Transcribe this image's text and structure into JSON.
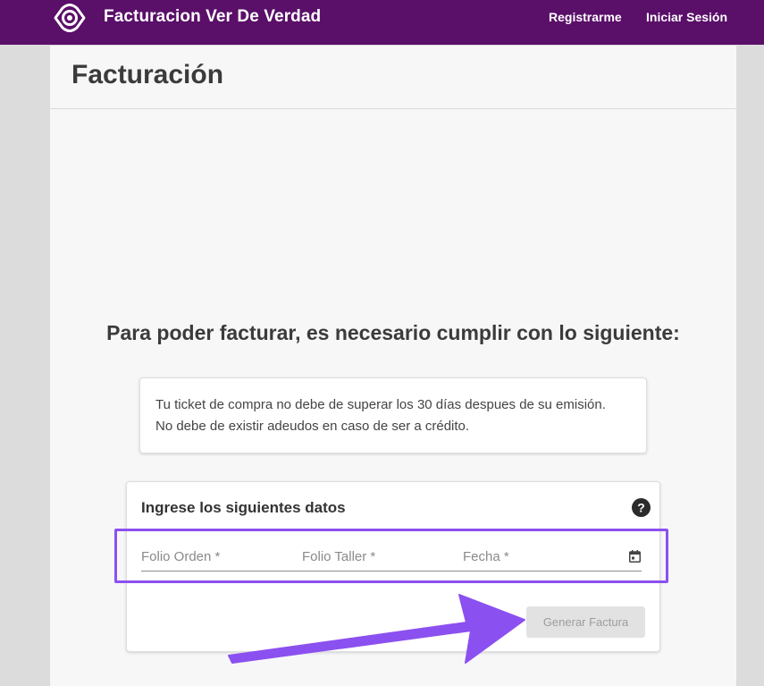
{
  "header": {
    "app_title": "Facturacion Ver De Verdad",
    "nav": {
      "register": "Registrarme",
      "login": "Iniciar Sesión"
    },
    "logo_icon": "eye-logo-icon",
    "background_color": "#5a0f69"
  },
  "page": {
    "title": "Facturación"
  },
  "requirements": {
    "heading": "Para poder facturar, es necesario cumplir con lo siguiente:",
    "items": [
      "Tu ticket de compra no debe de superar los 30 días despues de su emisión.",
      "No debe de existir adeudos en caso de ser a crédito."
    ]
  },
  "form": {
    "title": "Ingrese los siguientes datos",
    "help_icon": "help-circle-icon",
    "fields": {
      "folio_orden": {
        "placeholder": "Folio Orden *",
        "value": ""
      },
      "folio_taller": {
        "placeholder": "Folio Taller *",
        "value": ""
      },
      "fecha": {
        "placeholder": "Fecha *",
        "value": ""
      }
    },
    "calendar_icon": "calendar-icon",
    "submit_label": "Generar Factura"
  },
  "annotation": {
    "highlight_color": "#8b50f0",
    "arrow_color": "#8b50f0"
  }
}
